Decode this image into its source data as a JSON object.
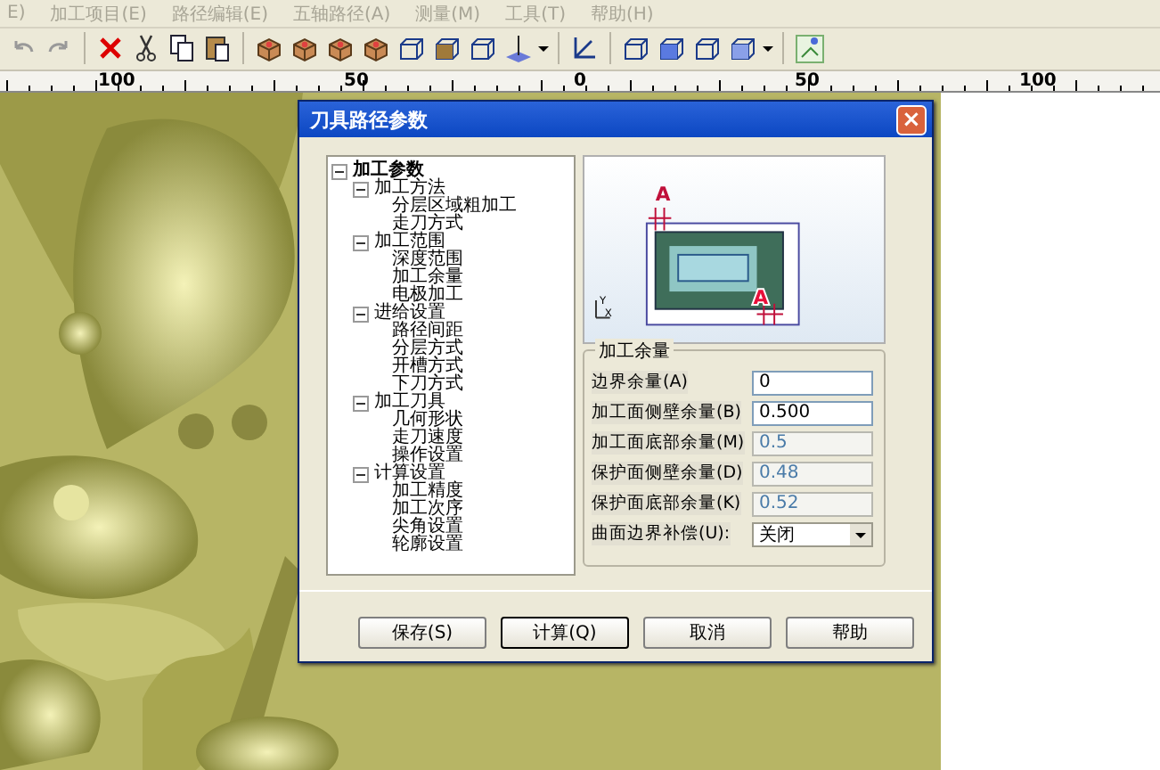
{
  "menu_bar": [
    {
      "label": "E)",
      "disabled": true
    },
    {
      "label": "加工项目(E)",
      "disabled": true
    },
    {
      "label": "路径编辑(E)",
      "disabled": true
    },
    {
      "label": "五轴路径(A)",
      "disabled": true
    },
    {
      "label": "测量(M)",
      "disabled": true
    },
    {
      "label": "工具(T)",
      "disabled": true
    },
    {
      "label": "帮助(H)",
      "disabled": true
    }
  ],
  "ruler": {
    "labels": [
      "100",
      "50",
      "0",
      "50",
      "100"
    ]
  },
  "dialog": {
    "title": "刀具路径参数",
    "close": "×",
    "tree": [
      {
        "label": "加工参数",
        "expanded": true,
        "children": [
          {
            "label": "加工方法",
            "expanded": true,
            "children": [
              {
                "label": "分层区域粗加工"
              },
              {
                "label": "走刀方式"
              }
            ]
          },
          {
            "label": "加工范围",
            "expanded": true,
            "children": [
              {
                "label": "深度范围"
              },
              {
                "label": "加工余量"
              },
              {
                "label": "电极加工"
              }
            ]
          },
          {
            "label": "进给设置",
            "expanded": true,
            "children": [
              {
                "label": "路径间距"
              },
              {
                "label": "分层方式"
              },
              {
                "label": "开槽方式"
              },
              {
                "label": "下刀方式"
              }
            ]
          },
          {
            "label": "加工刀具",
            "expanded": true,
            "children": [
              {
                "label": "几何形状"
              },
              {
                "label": "走刀速度"
              },
              {
                "label": "操作设置"
              }
            ]
          },
          {
            "label": "计算设置",
            "expanded": true,
            "children": [
              {
                "label": "加工精度"
              },
              {
                "label": "加工次序"
              },
              {
                "label": "尖角设置"
              },
              {
                "label": "轮廓设置"
              }
            ]
          }
        ]
      }
    ],
    "diagram": {
      "labels": [
        "A",
        "A"
      ],
      "axis_labels": [
        "Y",
        "X"
      ]
    },
    "group": {
      "title": "加工余量",
      "fields": [
        {
          "kind": "input",
          "label": "边界余量(A)",
          "value": "0",
          "disabled": false
        },
        {
          "kind": "input",
          "label": "加工面侧壁余量(B)",
          "value": "0.500",
          "disabled": false
        },
        {
          "kind": "input",
          "label": "加工面底部余量(M)",
          "value": "0.5",
          "disabled": true
        },
        {
          "kind": "input",
          "label": "保护面侧壁余量(D)",
          "value": "0.48",
          "disabled": true
        },
        {
          "kind": "input",
          "label": "保护面底部余量(K)",
          "value": "0.52",
          "disabled": true
        },
        {
          "kind": "select",
          "label": "曲面边界补偿(U):",
          "value": "关闭",
          "disabled": false
        }
      ]
    },
    "buttons": [
      {
        "label": "保存(S)",
        "default": false
      },
      {
        "label": "计算(Q)",
        "default": true
      },
      {
        "label": "取消",
        "default": false
      },
      {
        "label": "帮助",
        "default": false
      }
    ]
  }
}
